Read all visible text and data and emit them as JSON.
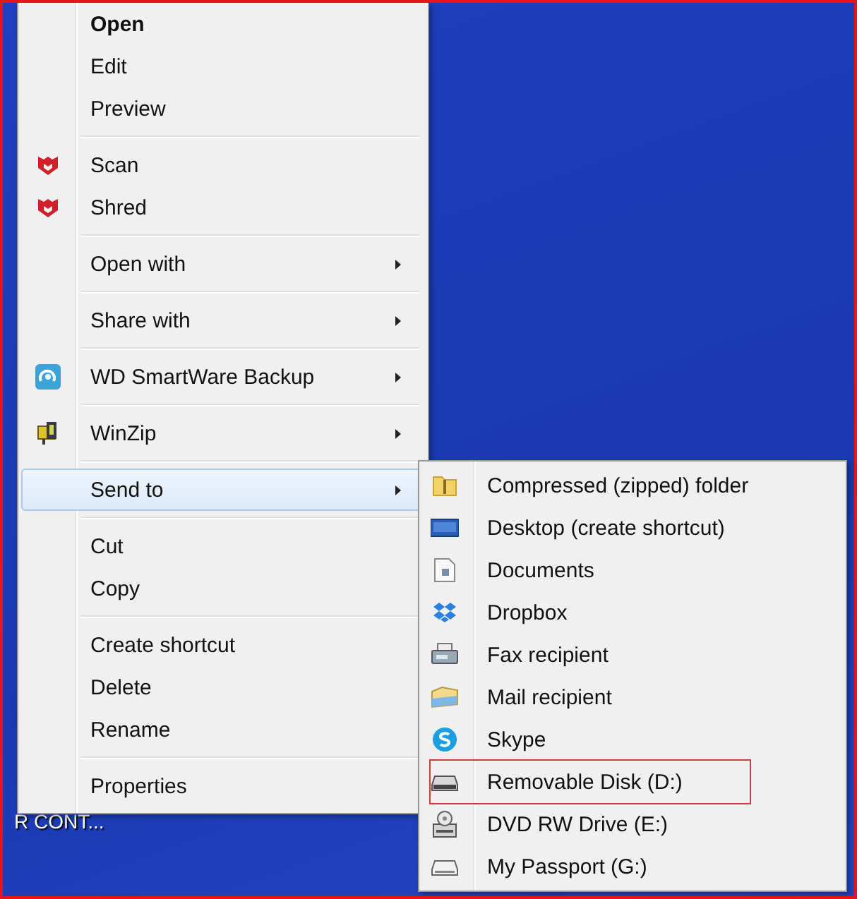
{
  "desktop": {
    "icon_label": "R CONT..."
  },
  "context_menu": {
    "groups": [
      [
        {
          "label": "Open",
          "default": true,
          "has_submenu": false,
          "highlighted": false
        },
        {
          "label": "Edit",
          "default": false,
          "has_submenu": false,
          "highlighted": false
        },
        {
          "label": "Preview",
          "default": false,
          "has_submenu": false,
          "highlighted": false
        }
      ],
      [
        {
          "label": "Scan",
          "default": false,
          "has_submenu": false,
          "highlighted": false
        },
        {
          "label": "Shred",
          "default": false,
          "has_submenu": false,
          "highlighted": false
        }
      ],
      [
        {
          "label": "Open with",
          "default": false,
          "has_submenu": true,
          "highlighted": false
        }
      ],
      [
        {
          "label": "Share with",
          "default": false,
          "has_submenu": true,
          "highlighted": false
        }
      ],
      [
        {
          "label": "WD SmartWare Backup",
          "default": false,
          "has_submenu": true,
          "highlighted": false
        }
      ],
      [
        {
          "label": "WinZip",
          "default": false,
          "has_submenu": true,
          "highlighted": false
        }
      ],
      [
        {
          "label": "Send to",
          "default": false,
          "has_submenu": true,
          "highlighted": true
        }
      ],
      [
        {
          "label": "Cut",
          "default": false,
          "has_submenu": false,
          "highlighted": false
        },
        {
          "label": "Copy",
          "default": false,
          "has_submenu": false,
          "highlighted": false
        }
      ],
      [
        {
          "label": "Create shortcut",
          "default": false,
          "has_submenu": false,
          "highlighted": false
        },
        {
          "label": "Delete",
          "default": false,
          "has_submenu": false,
          "highlighted": false
        },
        {
          "label": "Rename",
          "default": false,
          "has_submenu": false,
          "highlighted": false
        }
      ],
      [
        {
          "label": "Properties",
          "default": false,
          "has_submenu": false,
          "highlighted": false
        }
      ]
    ]
  },
  "send_to_menu": {
    "items": [
      {
        "label": "Compressed (zipped) folder",
        "outlined": false
      },
      {
        "label": "Desktop (create shortcut)",
        "outlined": false
      },
      {
        "label": "Documents",
        "outlined": false
      },
      {
        "label": "Dropbox",
        "outlined": false
      },
      {
        "label": "Fax recipient",
        "outlined": false
      },
      {
        "label": "Mail recipient",
        "outlined": false
      },
      {
        "label": "Skype",
        "outlined": false
      },
      {
        "label": "Removable Disk (D:)",
        "outlined": true
      },
      {
        "label": "DVD RW Drive (E:)",
        "outlined": false
      },
      {
        "label": "My Passport (G:)",
        "outlined": false
      }
    ]
  }
}
